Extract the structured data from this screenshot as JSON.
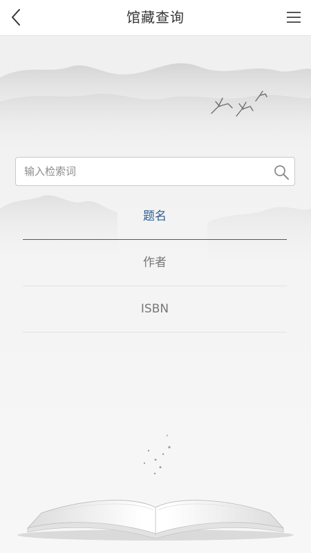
{
  "header": {
    "title": "馆藏查询",
    "back_icon": "chevron-left-icon",
    "menu_icon": "hamburger-menu-icon"
  },
  "search": {
    "placeholder": "输入检索词",
    "value": "",
    "icon": "search-icon"
  },
  "search_fields": [
    {
      "label": "题名",
      "active": true
    },
    {
      "label": "作者",
      "active": false
    },
    {
      "label": "ISBN",
      "active": false
    }
  ],
  "colors": {
    "accent": "#2c5d93",
    "header_bg": "#ffffff",
    "page_bg": "#f3f3f3",
    "text_muted": "#777777"
  }
}
